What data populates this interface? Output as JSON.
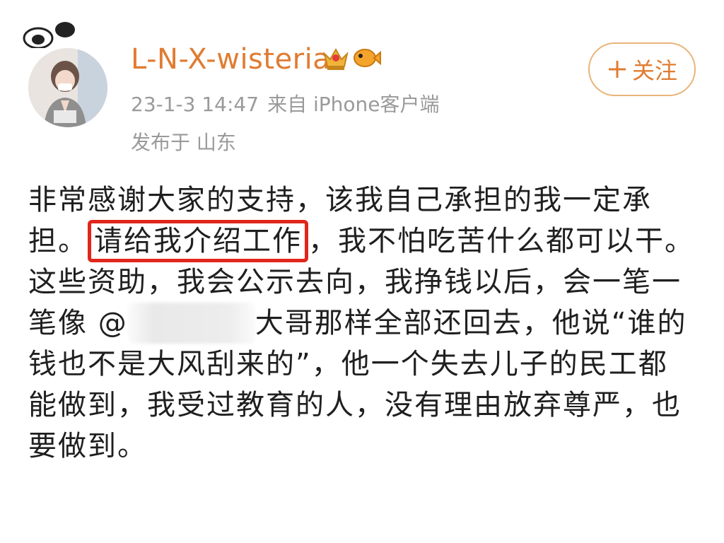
{
  "header": {
    "username": "L-N-X-wisteria",
    "timestamp": "23-1-3 14:47",
    "source": "来自 iPhone客户端",
    "location": "发布于 山东",
    "follow_label": "关注"
  },
  "icons": {
    "avatar": "avatar-photo",
    "badge1": "crown-badge-icon",
    "badge2": "fish-badge-icon",
    "follow": "plus-icon"
  },
  "colors": {
    "username": "#e07c31",
    "meta": "#9a9a9a",
    "highlight_border": "#e0261c",
    "follow_border": "#e9b47a"
  },
  "post": {
    "line1": "非常感谢大家的支持，该我自己承担的我一定承",
    "line2_prefix": "担。",
    "line2_highlight": "请给我介绍工作",
    "line2_suffix": "，我不怕吃苦什么都可以干。",
    "line3": "这些资助，我会公示去向，我挣钱以后，会一笔一",
    "line4_prefix": "笔像 @",
    "line4_suffix": "大哥那样全部还回去，他说“谁的",
    "line5": "钱也不是大风刮来的”，他一个失去儿子的民工都",
    "line6": "能做到，我受过教育的人，没有理由放弃尊严，也",
    "line7": "要做到。"
  }
}
